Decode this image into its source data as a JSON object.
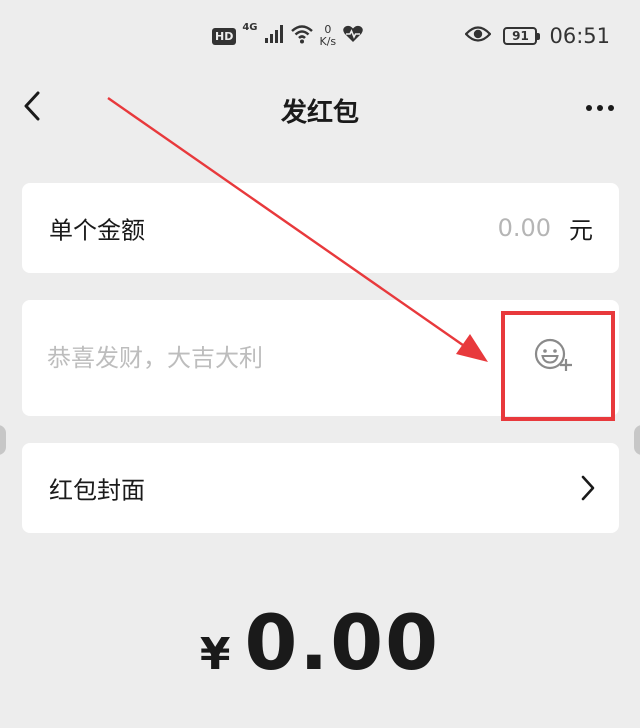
{
  "status_bar": {
    "hd_label": "HD",
    "network_label": "4G",
    "net_speed_value": "0",
    "net_speed_unit": "K/s",
    "battery_level": "91",
    "time": "06:51",
    "icons": [
      "signal-bars-icon",
      "wifi-icon",
      "heart-pulse-icon",
      "eye-icon",
      "battery-icon"
    ]
  },
  "nav": {
    "title": "发红包",
    "back_icon": "chevron-left-icon",
    "more_icon": "more-dots-icon"
  },
  "amount_row": {
    "label": "单个金额",
    "value_placeholder": "0.00",
    "unit": "元"
  },
  "greeting": {
    "placeholder": "恭喜发财，大吉大利",
    "emoji_icon": "emoji-add-icon"
  },
  "cover_row": {
    "label": "红包封面",
    "chevron_icon": "chevron-right-icon"
  },
  "total": {
    "currency": "¥",
    "value": "0.00"
  },
  "colors": {
    "background": "#ededed",
    "card": "#ffffff",
    "annotation_red": "#e8393c",
    "placeholder_gray": "#bdbdbd"
  }
}
